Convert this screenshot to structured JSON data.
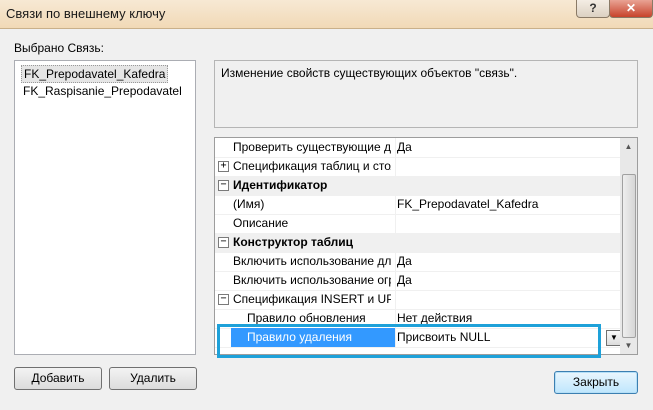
{
  "window": {
    "title": "Связи по внешнему ключу",
    "help_glyph": "?",
    "close_glyph": "✕"
  },
  "left": {
    "label": "Выбрано Связь:",
    "items": [
      "FK_Prepodavatel_Kafedra",
      "FK_Raspisanie_Prepodavatel"
    ]
  },
  "description": "Изменение свойств существующих объектов \"связь\".",
  "grid": {
    "rows": [
      {
        "name": "Проверить существующие да",
        "value": "Да",
        "type": "prop"
      },
      {
        "name": "Спецификация таблиц и стол",
        "value": "",
        "type": "expandable",
        "expander": "+"
      },
      {
        "name": "Идентификатор",
        "value": "",
        "type": "category",
        "expander": "−"
      },
      {
        "name": "(Имя)",
        "value": "FK_Prepodavatel_Kafedra",
        "type": "prop"
      },
      {
        "name": "Описание",
        "value": "",
        "type": "prop"
      },
      {
        "name": "Конструктор таблиц",
        "value": "",
        "type": "category",
        "expander": "−"
      },
      {
        "name": "Включить использование для",
        "value": "Да",
        "type": "prop"
      },
      {
        "name": "Включить использование огр",
        "value": "Да",
        "type": "prop"
      },
      {
        "name": "Спецификация INSERT и UPDA",
        "value": "",
        "type": "expandable",
        "expander": "−"
      },
      {
        "name": "Правило обновления",
        "value": "Нет действия",
        "type": "subprop"
      },
      {
        "name": "Правило удаления",
        "value": "Присвоить NULL",
        "type": "selected"
      }
    ],
    "dropdown_glyph": "▼",
    "scroll_up": "▲",
    "scroll_down": "▼"
  },
  "buttons": {
    "add": "Добавить",
    "delete": "Удалить",
    "close": "Закрыть"
  },
  "colors": {
    "selection": "#3399ff",
    "highlight_box": "#1ea1d9",
    "titlebar": "#f1d9b6",
    "close_button": "#c7432b"
  }
}
